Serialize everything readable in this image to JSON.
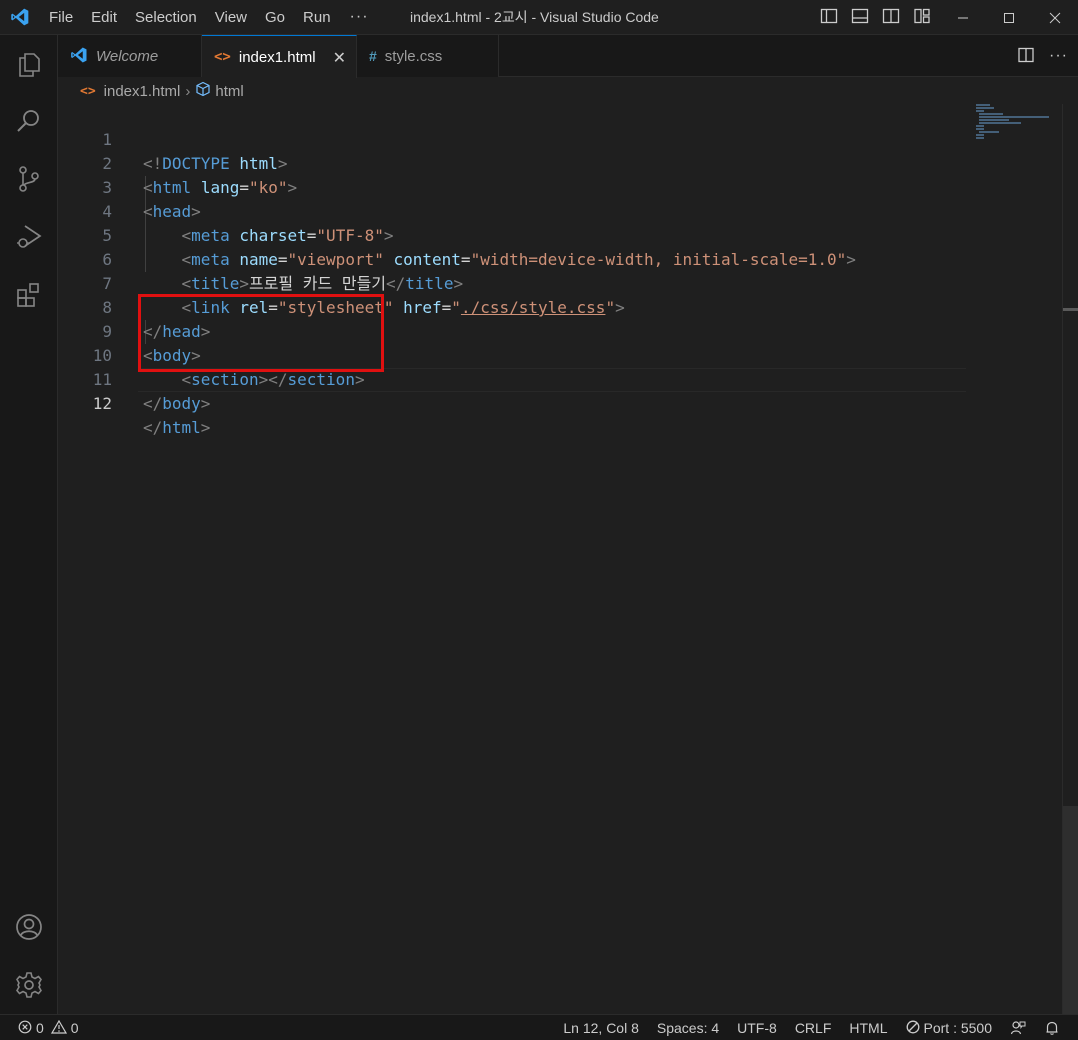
{
  "app": {
    "window_title": "index1.html - 2교시 - Visual Studio Code",
    "menu": [
      "File",
      "Edit",
      "Selection",
      "View",
      "Go",
      "Run",
      "···"
    ]
  },
  "tabs": [
    {
      "label": "Welcome",
      "icon": "vscode-icon",
      "active": false
    },
    {
      "label": "index1.html",
      "icon": "html-icon",
      "active": true
    },
    {
      "label": "style.css",
      "icon": "css-icon",
      "active": false
    }
  ],
  "breadcrumb": {
    "file": "index1.html",
    "symbol": "html"
  },
  "editor": {
    "line_numbers": [
      "1",
      "2",
      "3",
      "4",
      "5",
      "6",
      "7",
      "8",
      "9",
      "10",
      "11",
      "12"
    ],
    "code": {
      "l1": {
        "open": "<!",
        "doctype": "DOCTYPE",
        "html": "html",
        "close": ">"
      },
      "l2": {
        "lt": "<",
        "tag": "html",
        "attr": "lang",
        "eq": "=",
        "val": "\"ko\"",
        "gt": ">"
      },
      "l3": {
        "lt": "<",
        "tag": "head",
        "gt": ">"
      },
      "l4": {
        "lt": "<",
        "tag": "meta",
        "attr": "charset",
        "eq": "=",
        "val": "\"UTF-8\"",
        "gt": ">"
      },
      "l5": {
        "lt": "<",
        "tag": "meta",
        "attr1": "name",
        "eq": "=",
        "val1": "\"viewport\"",
        "attr2": "content",
        "val2": "\"width=device-width, initial-scale=1.0\"",
        "gt": ">"
      },
      "l6": {
        "lt": "<",
        "tag": "title",
        "gt": ">",
        "text": "프로필 카드 만들기",
        "close_lt": "</",
        "close_tag": "title",
        "close_gt": ">"
      },
      "l7": {
        "lt": "<",
        "tag": "link",
        "attr1": "rel",
        "eq": "=",
        "val1": "\"stylesheet\"",
        "attr2": "href",
        "q1": "\"",
        "link": "./css/style.css",
        "q2": "\"",
        "gt": ">"
      },
      "l8": {
        "lt": "</",
        "tag": "head",
        "gt": ">"
      },
      "l9": {
        "lt": "<",
        "tag": "body",
        "gt": ">"
      },
      "l10": {
        "lt": "<",
        "tag": "section",
        "gt": ">",
        "close_lt": "</",
        "close_tag": "section",
        "close_gt": ">"
      },
      "l11": {
        "lt": "</",
        "tag": "body",
        "gt": ">"
      },
      "l12": {
        "lt": "</",
        "tag": "html",
        "gt": ">"
      }
    }
  },
  "status": {
    "errors": "0",
    "warnings": "0",
    "position": "Ln 12, Col 8",
    "spaces": "Spaces: 4",
    "encoding": "UTF-8",
    "eol": "CRLF",
    "language": "HTML",
    "port": "Port : 5500"
  },
  "colors": {
    "highlight_box": "#e01010",
    "active_tab_accent": "#0078d4",
    "tag": "#569cd6",
    "attribute": "#9cdcfe",
    "string": "#ce9178"
  }
}
